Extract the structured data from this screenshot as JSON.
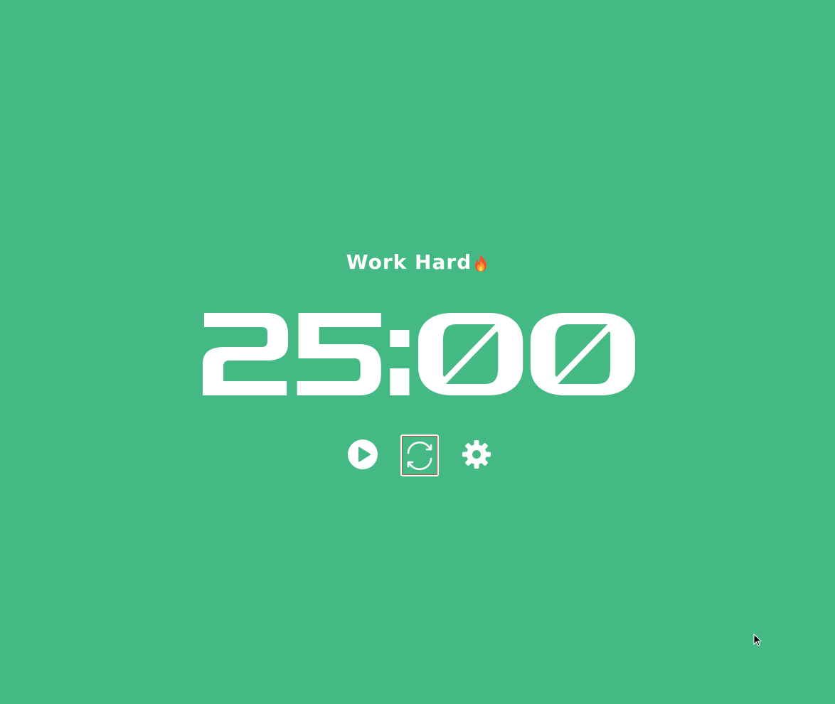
{
  "app": {
    "background_color": "#44b984",
    "foreground_color": "#ffffff",
    "focus_ring_color": "#c0503f"
  },
  "session": {
    "label": "Work Hard",
    "emoji": "🔥"
  },
  "timer": {
    "minutes": "25",
    "separator": ":",
    "seconds": "00"
  },
  "controls": {
    "play": {
      "icon": "play-icon"
    },
    "reset": {
      "icon": "refresh-icon",
      "focused": true
    },
    "settings": {
      "icon": "gear-icon"
    }
  }
}
